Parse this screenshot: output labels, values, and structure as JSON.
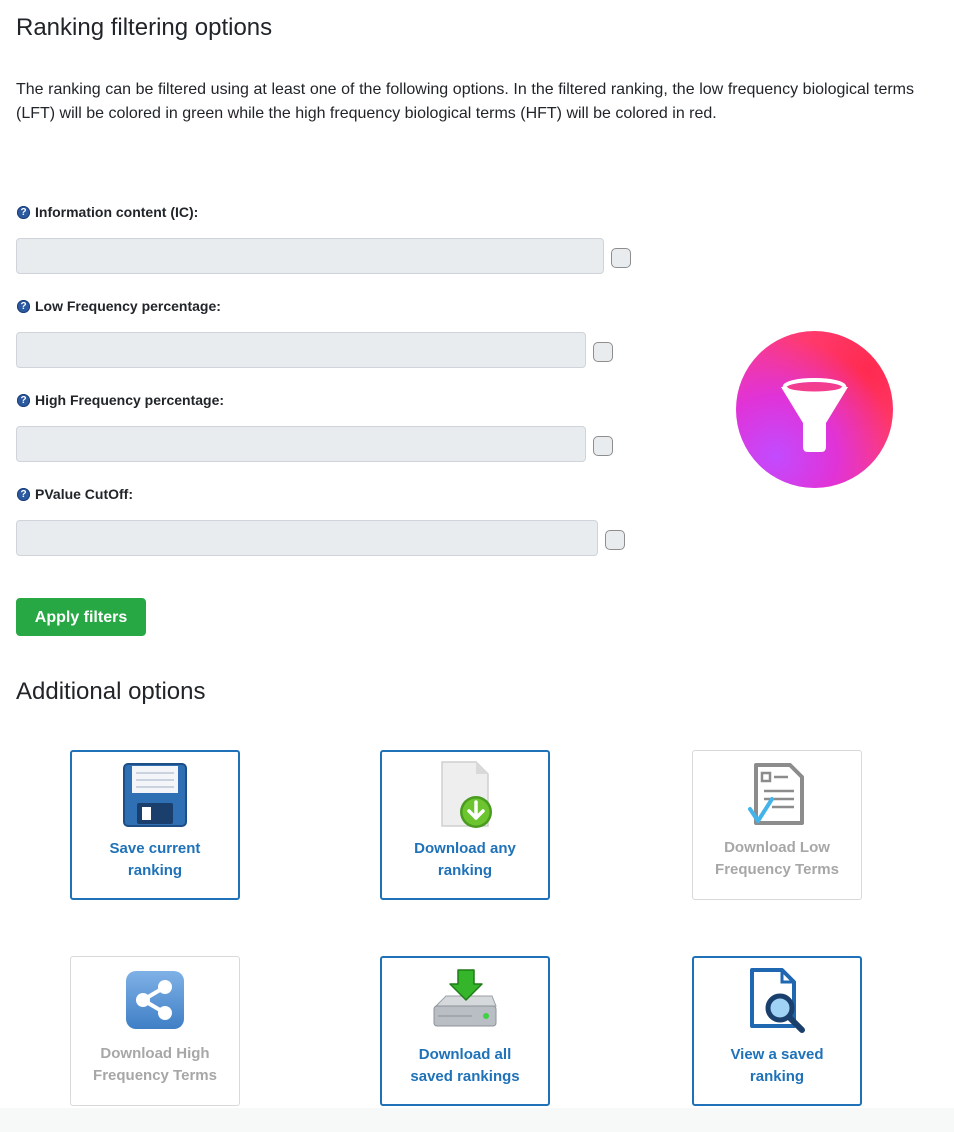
{
  "page": {
    "title": "Ranking filtering options",
    "intro": "The ranking can be filtered using at least one of the following options. In the filtered ranking, the low frequency biological terms (LFT) will be colored in green while the high frequency biological terms (HFT) will be colored in red."
  },
  "filters": [
    {
      "label": "Information content (IC):",
      "value": "",
      "checked": false
    },
    {
      "label": "Low Frequency percentage:",
      "value": "",
      "checked": false
    },
    {
      "label": "High Frequency percentage:",
      "value": "",
      "checked": false
    },
    {
      "label": "PValue CutOff:",
      "value": "",
      "checked": false
    }
  ],
  "apply_button": "Apply filters",
  "additional": {
    "title": "Additional options",
    "cards": [
      {
        "label": "Save current\nranking",
        "icon": "floppy-disk-icon",
        "enabled": true
      },
      {
        "label": "Download any\nranking",
        "icon": "document-download-icon",
        "enabled": true
      },
      {
        "label": "Download Low\nFrequency Terms",
        "icon": "checklist-document-icon",
        "enabled": false
      },
      {
        "label": "Download High\nFrequency Terms",
        "icon": "share-icon",
        "enabled": false
      },
      {
        "label": "Download all\nsaved rankings",
        "icon": "hard-drive-download-icon",
        "enabled": true
      },
      {
        "label": "View a saved\nranking",
        "icon": "document-search-icon",
        "enabled": true
      }
    ]
  },
  "colors": {
    "accent": "#1f72b8",
    "success": "#28a745",
    "disabled": "#a7a7a7"
  }
}
